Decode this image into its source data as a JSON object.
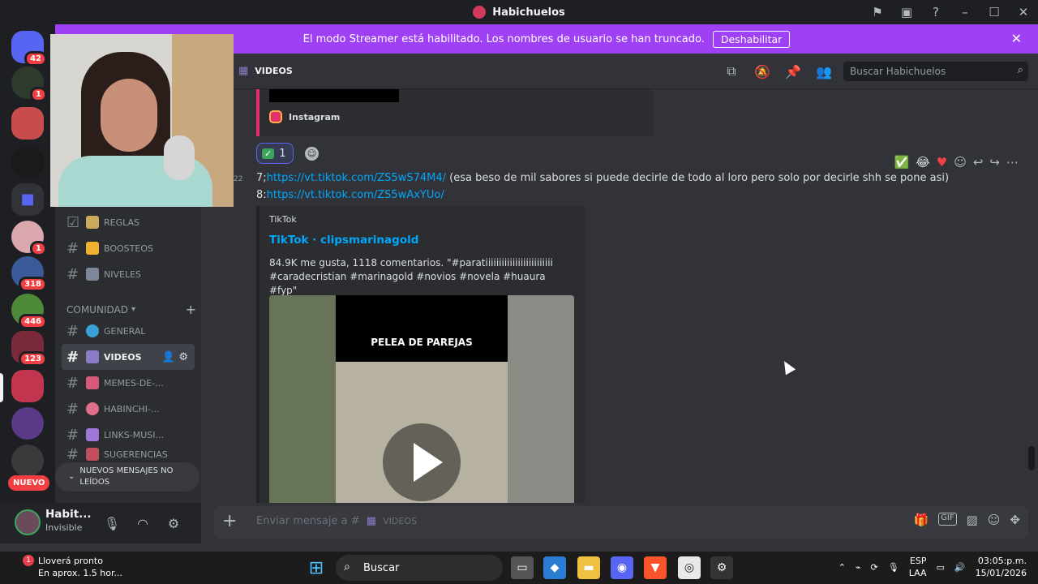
{
  "window": {
    "title": "Habichuelos"
  },
  "banner": {
    "text": "El modo Streamer está habilitado. Los nombres de usuario se han truncado.",
    "button": "Deshabilitar"
  },
  "guilds": {
    "badges": [
      "42",
      "1",
      "1",
      "318",
      "446",
      "123"
    ],
    "nuevo": "NUEVO"
  },
  "channels": {
    "items": [
      {
        "label": "REGLAS",
        "color": "#c9a95c"
      },
      {
        "label": "BOOSTEOS",
        "color": "#f0b132"
      },
      {
        "label": "NIVELES",
        "color": "#7d8799"
      }
    ],
    "category": "COMUNIDAD",
    "community": [
      {
        "label": "GENERAL",
        "color": "#3aa0d8"
      },
      {
        "label": "VIDEOS",
        "color": "#8a7cc7"
      },
      {
        "label": "MEMES-DE-...",
        "color": "#d9597a"
      },
      {
        "label": "HABINCHI-...",
        "color": "#e0708a"
      },
      {
        "label": "LINKS-MUSI...",
        "color": "#9c77d6"
      },
      {
        "label": "SUGERENCIAS",
        "color": "#c34e5d"
      }
    ],
    "unread": "NUEVOS MENSAJES NO LEÍDOS"
  },
  "user": {
    "name": "Habit...",
    "status": "Invisible"
  },
  "header": {
    "channel": "VIDEOS",
    "search_placeholder": "Buscar Habichuelos"
  },
  "messages": {
    "embed_source": "Instagram",
    "reaction_count": "1",
    "time": "22",
    "line7_prefix": "7;",
    "line7_link": "https://vt.tiktok.com/ZS5wS74M4/",
    "line7_text": " (esa beso de mil sabores si puede decirle de todo al loro pero solo por decirle shh se pone asi)",
    "line8_prefix": "8:",
    "line8_link": "https://vt.tiktok.com/ZS5wAxYUo/",
    "embed": {
      "provider": "TikTok",
      "title": "TikTok · clipsmarinagold",
      "description": "84.9K me gusta, 1118 comentarios. \"#paratiiiiiiiiiiiiiiiiiiiiiiiii #caradecristian #marinagold #novios #novela #huaura #fyp\"",
      "video_caption": "PELEA DE PAREJAS"
    }
  },
  "composer": {
    "placeholder": "Enviar mensaje a #",
    "channel": "VIDEOS"
  },
  "taskbar": {
    "weather_line1": "Lloverá pronto",
    "weather_line2": "En aprox. 1.5 hor...",
    "weather_badge": "1",
    "search": "Buscar",
    "lang1": "ESP",
    "lang2": "LAA",
    "time": "03:05:p.m.",
    "date": "15/01/2026"
  }
}
